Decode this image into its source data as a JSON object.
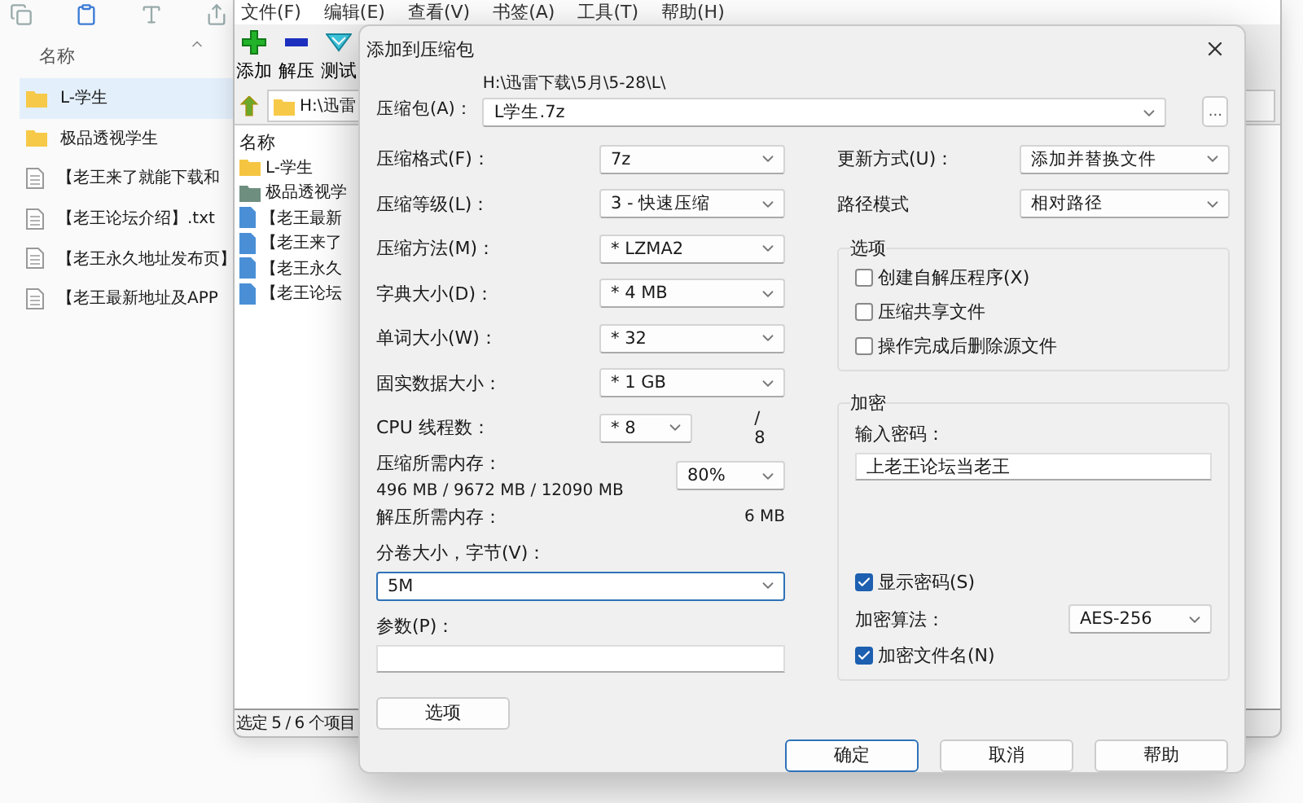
{
  "explorer": {
    "column_header": "名称",
    "items": [
      {
        "name": "L-学生",
        "kind": "folder",
        "selected": true
      },
      {
        "name": "极品透视学生",
        "kind": "folder",
        "selected": false
      },
      {
        "name": "【老王来了就能下载和",
        "kind": "file",
        "selected": false
      },
      {
        "name": "【老王论坛介绍】.txt",
        "kind": "file",
        "selected": false
      },
      {
        "name": "【老王永久地址发布页】",
        "kind": "file",
        "selected": false
      },
      {
        "name": "【老王最新地址及APP",
        "kind": "file",
        "selected": false
      }
    ]
  },
  "file_manager": {
    "menu": [
      "文件(F)",
      "编辑(E)",
      "查看(V)",
      "书签(A)",
      "工具(T)",
      "帮助(H)"
    ],
    "toolbar": [
      {
        "label": "添加",
        "kind": "add"
      },
      {
        "label": "解压",
        "kind": "extract"
      },
      {
        "label": "测试",
        "kind": "test"
      }
    ],
    "address": "H:\\迅雷",
    "column_header": "名称",
    "items": [
      {
        "name": "L-学生",
        "color": "#f5c542"
      },
      {
        "name": "极品透视学",
        "color": "#6e8f80"
      },
      {
        "name": "【老王最新",
        "color": "#4a8fd6"
      },
      {
        "name": "【老王来了",
        "color": "#4a8fd6"
      },
      {
        "name": "【老王永久",
        "color": "#4a8fd6"
      },
      {
        "name": "【老王论坛",
        "color": "#4a8fd6"
      }
    ],
    "status": "选定 5 / 6 个项目"
  },
  "dialog": {
    "title": "添加到压缩包",
    "archive": {
      "label": "压缩包(A)：",
      "path": "H:\\迅雷下载\\5月\\5-28\\L\\",
      "value": "L学生.7z",
      "browse": "..."
    },
    "left_fields": [
      {
        "kind": "select",
        "label": "压缩格式(F)：",
        "value": "7z"
      },
      {
        "kind": "select",
        "label": "压缩等级(L)：",
        "value": "3 - 快速压缩"
      },
      {
        "kind": "select",
        "label": "压缩方法(M)：",
        "value": "*  LZMA2"
      },
      {
        "kind": "select",
        "label": "字典大小(D)：",
        "value": "*  4 MB"
      },
      {
        "kind": "select",
        "label": "单词大小(W)：",
        "value": "*  32"
      },
      {
        "kind": "select",
        "label": "固实数据大小：",
        "value": "*  1 GB"
      },
      {
        "kind": "count",
        "label": "CPU 线程数：",
        "value": "*  8",
        "suffix": "/ 8"
      },
      {
        "kind": "memory",
        "label": "压缩所需内存：",
        "detail": "496 MB / 9672 MB / 12090 MB",
        "value": "80%"
      },
      {
        "kind": "info",
        "label": "解压所需内存：",
        "value": "6 MB"
      },
      {
        "kind": "combo",
        "label": "分卷大小，字节(V)：",
        "value": "5M",
        "focused": true
      },
      {
        "kind": "input",
        "label": "参数(P)："
      }
    ],
    "right_fields": [
      {
        "label": "更新方式(U)：",
        "value": "添加并替换文件"
      },
      {
        "label": "路径模式",
        "value": "相对路径"
      }
    ],
    "options_group": {
      "title": "选项",
      "checkboxes": [
        {
          "label": "创建自解压程序(X)",
          "checked": false
        },
        {
          "label": "压缩共享文件",
          "checked": false
        },
        {
          "label": "操作完成后删除源文件",
          "checked": false
        }
      ]
    },
    "encryption": {
      "title": "加密",
      "password_label": "输入密码：",
      "password": "上老王论坛当老王",
      "show_password": {
        "label": "显示密码(S)",
        "checked": true
      },
      "method_label": "加密算法：",
      "method": "AES-256",
      "encrypt_names": {
        "label": "加密文件名(N)",
        "checked": true
      }
    },
    "options_button": "选项",
    "buttons": [
      {
        "label": "确定",
        "default": true
      },
      {
        "label": "取消",
        "default": false
      },
      {
        "label": "帮助",
        "default": false
      }
    ]
  }
}
